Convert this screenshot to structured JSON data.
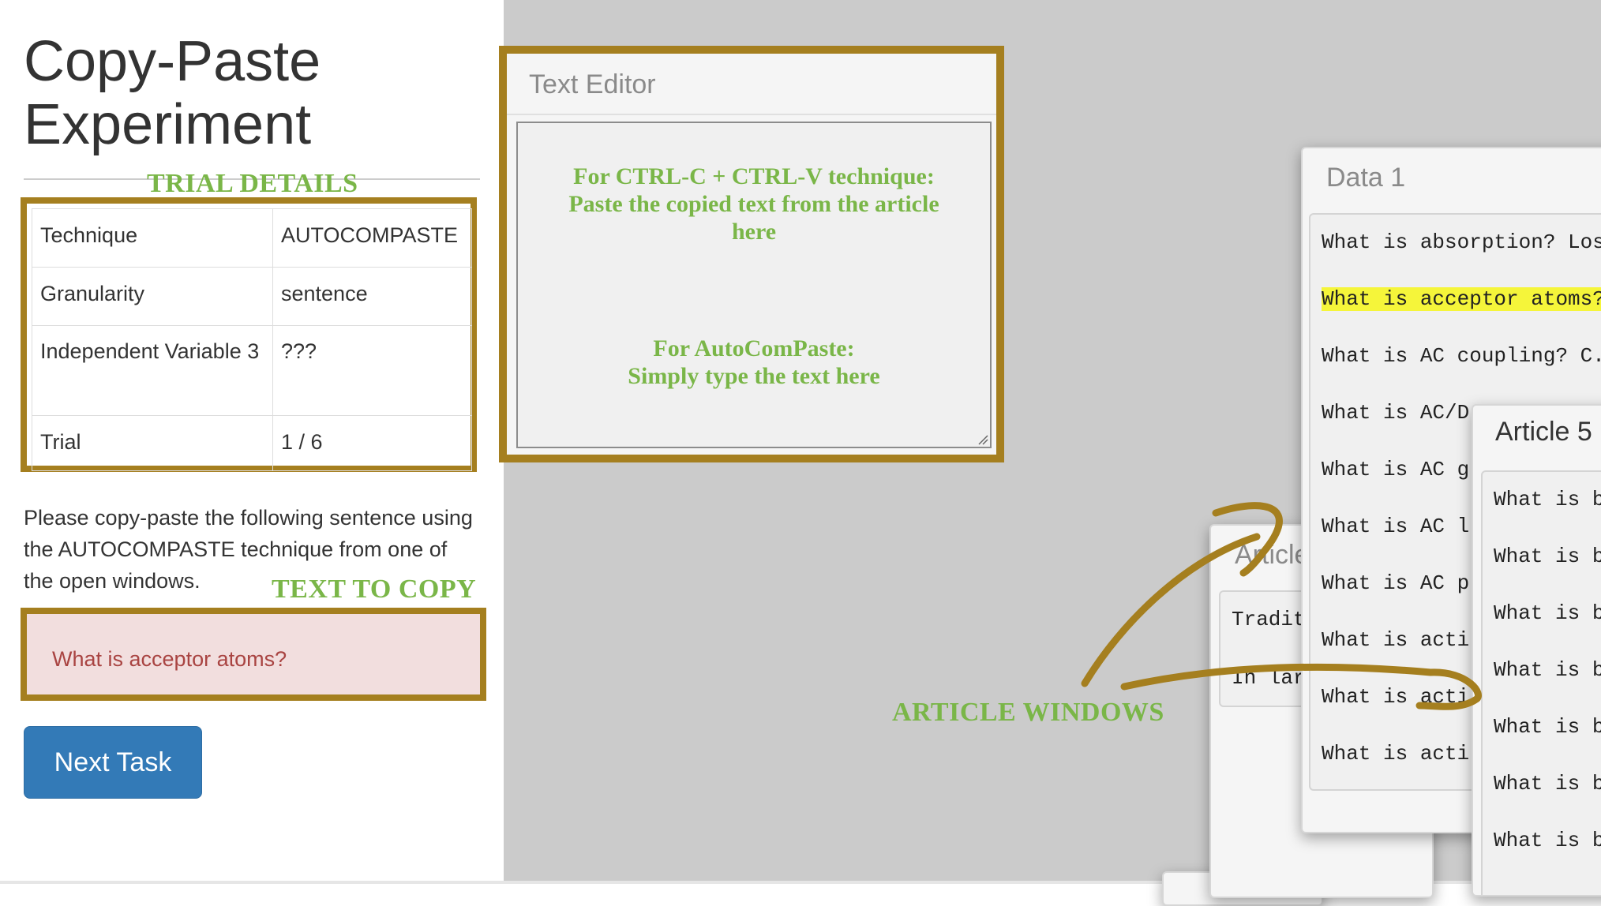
{
  "page": {
    "title": "Copy-Paste Experiment"
  },
  "annotations": {
    "trial_details": "TRIAL DETAILS",
    "text_to_copy": "TEXT TO COPY",
    "article_windows": "ARTICLE WINDOWS",
    "accent_color": "#7ab648",
    "frame_color": "#a57f1f"
  },
  "trial": {
    "rows": [
      {
        "key": "Technique",
        "value": "AUTOCOMPASTE"
      },
      {
        "key": "Granularity",
        "value": "sentence"
      },
      {
        "key": "Independent Variable 3",
        "value": "???"
      },
      {
        "key": "Trial",
        "value": "1 / 6"
      }
    ]
  },
  "instructions": "Please copy-paste the following sentence using the AUTOCOMPASTE technique from one of the open windows.",
  "target_text": "What is acceptor atoms?",
  "next_button": "Next Task",
  "editor": {
    "title": "Text Editor",
    "note_ctrl_lines": [
      "For CTRL-C + CTRL-V technique:",
      "Paste the copied text from the article",
      "here"
    ],
    "note_auto_lines": [
      "For AutoComPaste:",
      "Simply type the text here"
    ]
  },
  "windows": {
    "article_back": {
      "title": "Article",
      "lines": [
        "Tradit",
        "In lar"
      ]
    },
    "data1": {
      "title": "Data 1",
      "lines": [
        "What is absorption? Los",
        "What is acceptor atoms?",
        "What is AC coupling? C.",
        "What is AC/D",
        "What is AC g",
        "What is AC l",
        "What is AC p",
        "What is acti",
        "What is acti",
        "What is acti"
      ],
      "highlighted_index": 1,
      "highlight_color": "#f5f53a"
    },
    "article5": {
      "title": "Article 5",
      "lines": [
        "What is b",
        "What is b",
        "What is b",
        "What is b",
        "What is b",
        "What is b",
        "What is b"
      ]
    }
  }
}
